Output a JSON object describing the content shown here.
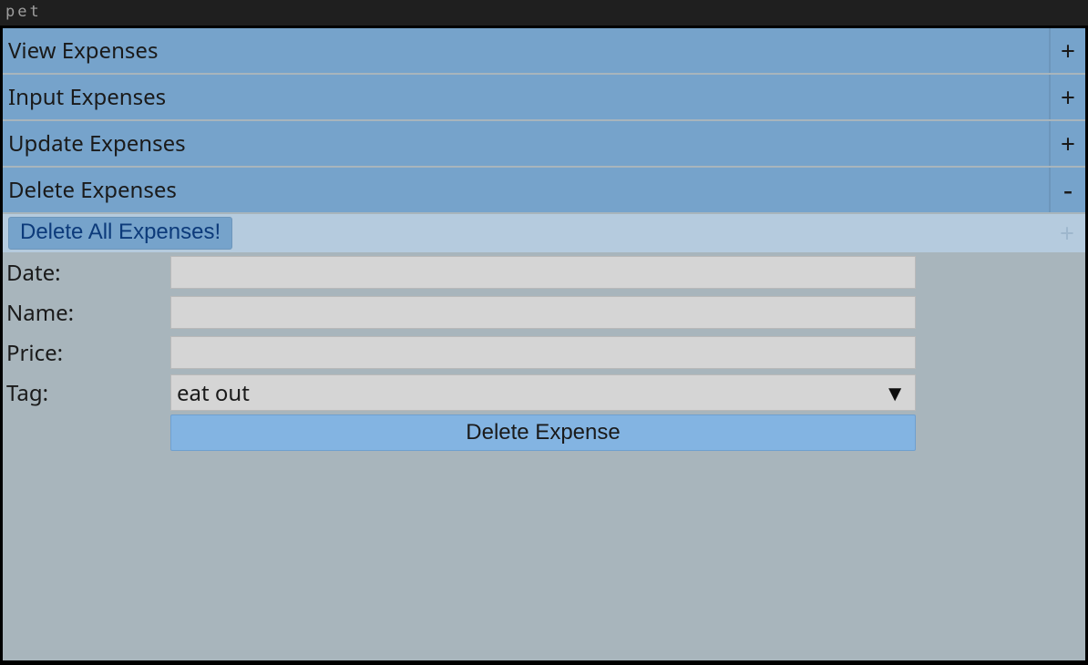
{
  "window_title": "pet",
  "accordion": {
    "items": [
      {
        "label": "View Expenses",
        "symbol": "+"
      },
      {
        "label": "Input Expenses",
        "symbol": "+"
      },
      {
        "label": "Update Expenses",
        "symbol": "+"
      },
      {
        "label": "Delete Expenses",
        "symbol": "-"
      }
    ]
  },
  "delete_expenses_panel": {
    "delete_all_label": "Delete All Expenses!",
    "ghost_plus": "+"
  },
  "form": {
    "date_label": "Date:",
    "date_value": "",
    "name_label": "Name:",
    "name_value": "",
    "price_label": "Price:",
    "price_value": "",
    "tag_label": "Tag:",
    "tag_value": "eat out",
    "submit_label": "Delete Expense"
  },
  "chevron_glyph": "▼"
}
